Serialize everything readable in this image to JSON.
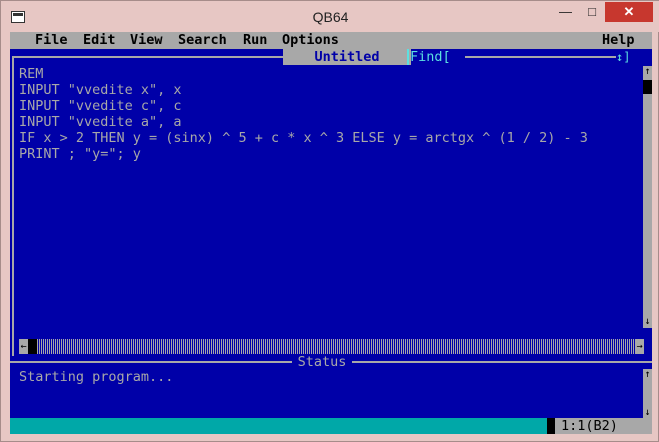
{
  "window": {
    "title": "QB64",
    "min_label": "—",
    "max_label": "□",
    "close_label": "✕"
  },
  "menu": {
    "items": [
      "File",
      "Edit",
      "View",
      "Search",
      "Run",
      "Options"
    ],
    "help": "Help"
  },
  "editor": {
    "title": "Untitled",
    "find_label": "Find[",
    "find_arrows": "↕]",
    "lines": [
      "REM",
      "INPUT \"vvedite x\", x",
      "INPUT \"vvedite c\", c",
      "INPUT \"vvedite a\", a",
      "IF x > 2 THEN y = (sinx) ^ 5 + c * x ^ 3 ELSE y = arctgx ^ (1 / 2) - 3",
      "PRINT ; \"y=\"; y"
    ]
  },
  "scroll": {
    "up": "↑",
    "down": "↓",
    "left": "←",
    "right": "→"
  },
  "status": {
    "title": "Status",
    "text": "Starting program..."
  },
  "bottom": {
    "position": "1:1(B2)"
  },
  "colors": {
    "background": "#0000a8",
    "menubar": "#a8a8a8",
    "text": "#a8a8a8",
    "statusbar": "#00a8a8"
  }
}
